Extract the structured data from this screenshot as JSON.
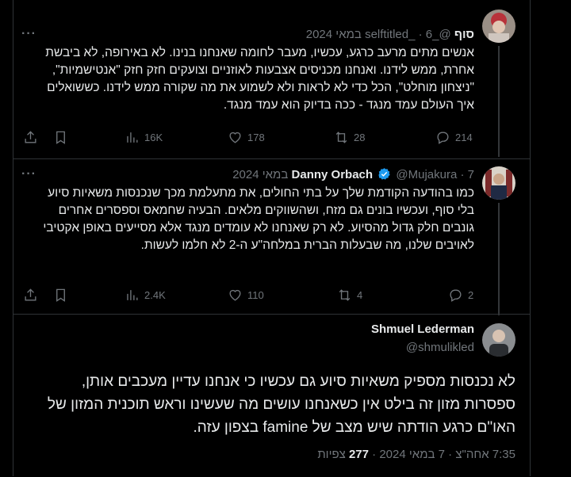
{
  "tweets": [
    {
      "display_name": "סוף",
      "handle": "@_selftitled_",
      "separator": "·",
      "date": "6 במאי 2024",
      "more": "···",
      "text": "אנשים מתים מרעב כרגע, עכשיו, מעבר לחומה שאנחנו בנינו. לא באירופה, לא ביבשת אחרת, ממש לידנו. ואנחנו מכניסים אצבעות לאוזניים וצועקים חזק חזק \"אנטישמיות\", \"ניצחון מוחלט\", הכל כדי לא לראות ולא לשמוע את מה שקורה ממש לידנו. כששואלים איך העולם עמד מנגד - ככה בדיוק הוא עמד מנגד.",
      "stats": {
        "views": "16K",
        "likes": "178",
        "reposts": "28",
        "replies": "214"
      }
    },
    {
      "display_name": "Danny Orbach",
      "handle": "@Mujakura",
      "separator": "·",
      "date": "7 במאי 2024",
      "more": "···",
      "text": "כמו בהודעה הקודמת שלך על בתי החולים, את מתעלמת מכך שנכנסות משאיות סיוע בלי סוף, ועכשיו בונים גם מזח, ושהשווקים מלאים. הבעיה שחמאס וספסרים אחרים גונבים חלק גדול מהסיוע. לא רק שאנחנו לא עומדים מנגד אלא מסייעים באופן אקטיבי לאויבים שלנו, מה שבעלות הברית במלחה\"ע ה-2 לא חלמו לעשות.",
      "stats": {
        "views": "2.4K",
        "likes": "110",
        "reposts": "4",
        "replies": "2"
      }
    }
  ],
  "main_tweet": {
    "display_name": "Shmuel Lederman",
    "handle": "@shmulikled",
    "text": "לא נכנסות מספיק משאיות סיוע גם עכשיו כי אנחנו עדיין מעכבים אותן, ספסרות מזון זה בילט אין כשאנחנו עושים מה שעשינו וראש תוכנית המזון של האו\"ם כרגע הודתה שיש מצב של famine בצפון עזה.",
    "timestamp": "7:35 אחה\"צ · 7 במאי 2024",
    "views_count": "277",
    "views_label": "צפיות",
    "dot": "·"
  },
  "colors": {
    "background": "#000000",
    "text": "#e7e9ea",
    "muted": "#71767b",
    "border": "#2f3336",
    "verified": "#1d9bf0"
  },
  "icons": [
    "share-icon",
    "bookmark-icon",
    "views-icon",
    "like-icon",
    "repost-icon",
    "reply-icon",
    "verified-badge-icon",
    "more-icon"
  ]
}
